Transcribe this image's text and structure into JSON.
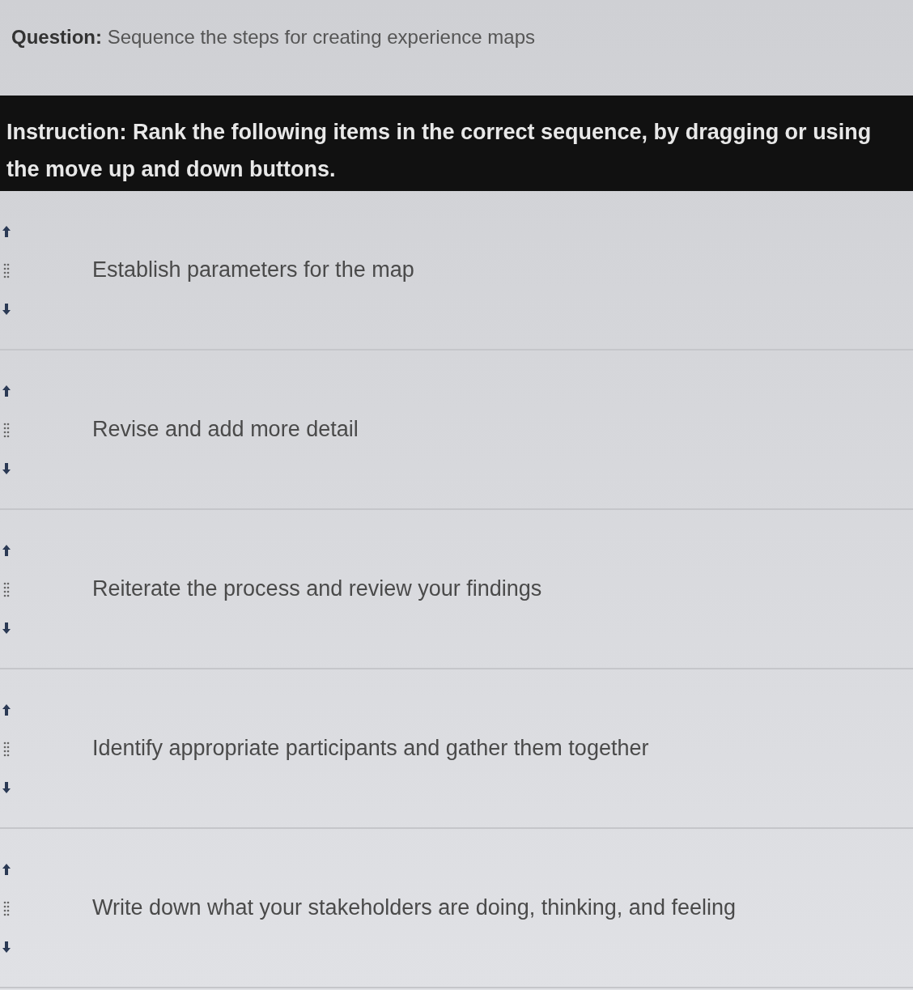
{
  "question": "**Question:** Sequence the steps for creating experience maps",
  "instruction": "Instruction: Rank the following items in the correct sequence, by dragging or using the move up and down buttons.",
  "items": [
    {
      "label": "Establish parameters for the map"
    },
    {
      "label": "Revise and add more detail"
    },
    {
      "label": "Reiterate the process and review your findings"
    },
    {
      "label": "Identify appropriate participants and gather them together"
    },
    {
      "label": "Write down what your stakeholders are doing, thinking, and feeling"
    }
  ]
}
